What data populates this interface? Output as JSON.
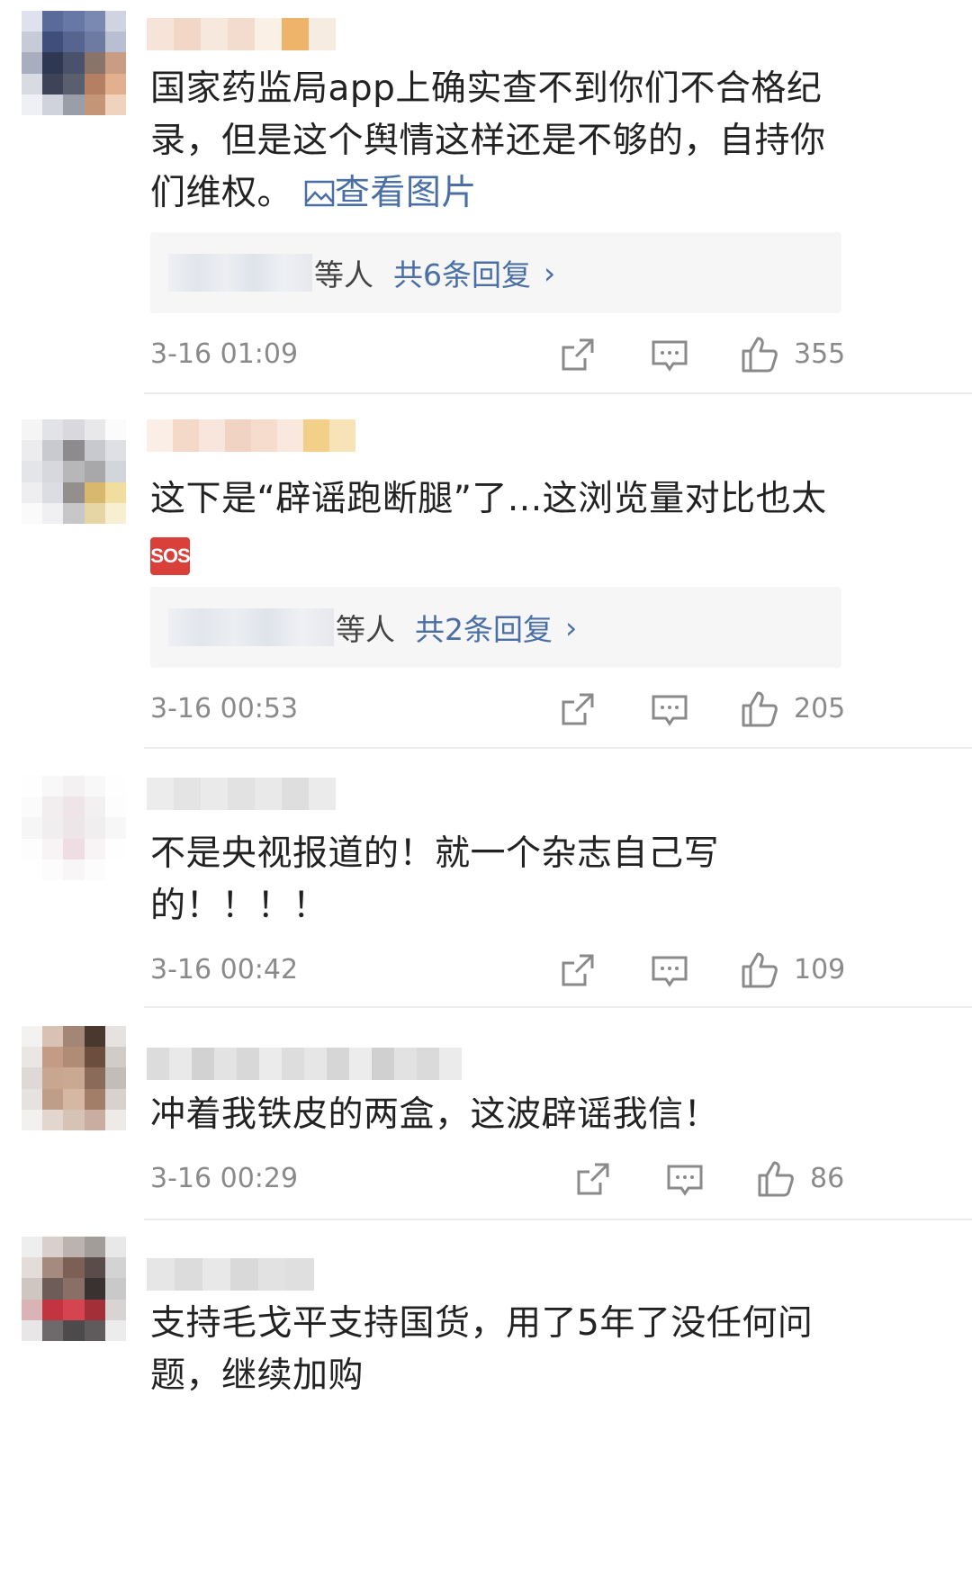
{
  "comments": [
    {
      "text": "国家药监局app上确实查不到你们不合格纪录，但是这个舆情这样还是不够的，自持你们维权。",
      "view_image": "查看图片",
      "reply_who": "等人",
      "reply_total": "共6条回复",
      "time": "3-16 01:09",
      "likes": "355"
    },
    {
      "text": "这下是“辟谣跑断腿”了...这浏览量对比也太",
      "emoji": "SOS",
      "reply_who": "等人",
      "reply_total": "共2条回复",
      "time": "3-16 00:53",
      "likes": "205"
    },
    {
      "text": "不是央视报道的！就一个杂志自己写的！！！！",
      "time": "3-16 00:42",
      "likes": "109"
    },
    {
      "text": "冲着我铁皮的两盒，这波辟谣我信！",
      "time": "3-16 00:29",
      "likes": "86"
    },
    {
      "text": "支持毛戈平支持国货，用了5年了没任何问题，继续加购"
    }
  ],
  "icons": {
    "share": "share-icon",
    "comment": "comment-icon",
    "like": "thumbs-up-icon",
    "view_image": "image-icon",
    "chevron": "chevron-right-icon"
  },
  "colors": {
    "link": "#4a6fa5",
    "meta": "#8a8a8a",
    "sos": "#d9403a"
  }
}
